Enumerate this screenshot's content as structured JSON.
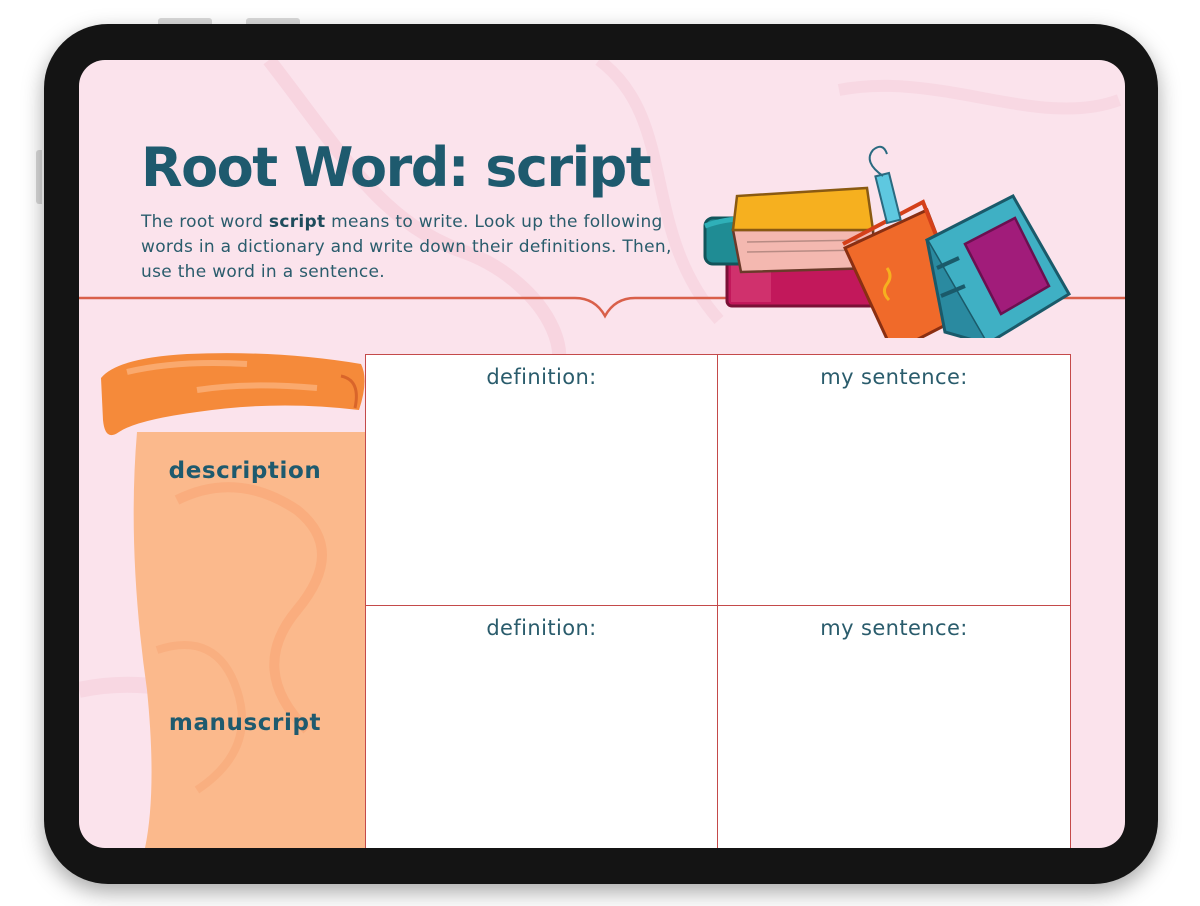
{
  "worksheet": {
    "title": "Root Word: script",
    "intro": {
      "before": "The root word ",
      "root": "script",
      "after": " means to write. Look up the following words in a dictionary and write down their definitions. Then, use the word in a sentence."
    }
  },
  "rows": [
    {
      "word": "description",
      "definition_label": "definition:",
      "sentence_label": "my sentence:"
    },
    {
      "word": "manuscript",
      "definition_label": "definition:",
      "sentence_label": "my sentence:"
    }
  ],
  "colors": {
    "page_background": "#fbe3ec",
    "title_text": "#1e5a6e",
    "grid_border": "#c44a4a",
    "scroll": "#fbb98c"
  },
  "icons": [
    "books-stack-illustration",
    "scroll-illustration"
  ]
}
